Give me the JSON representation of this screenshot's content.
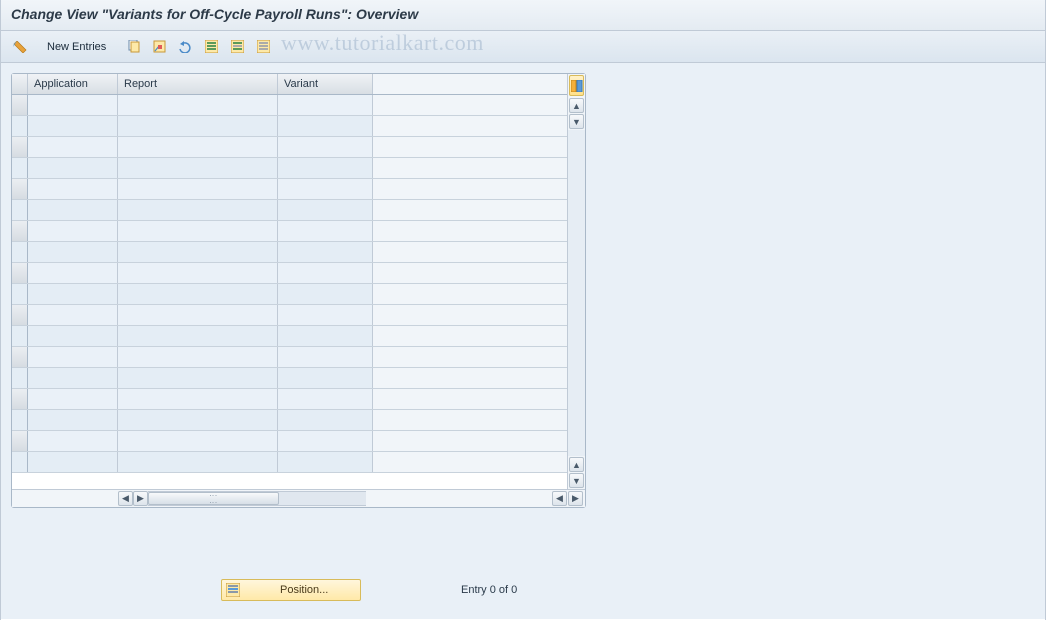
{
  "title": "Change View \"Variants for Off-Cycle Payroll Runs\": Overview",
  "toolbar": {
    "new_entries": "New Entries"
  },
  "watermark": "www.tutorialkart.com",
  "table": {
    "columns": [
      "Application",
      "Report",
      "Variant"
    ],
    "rows": [
      {
        "application": "",
        "report": "",
        "variant": ""
      },
      {
        "application": "",
        "report": "",
        "variant": ""
      },
      {
        "application": "",
        "report": "",
        "variant": ""
      },
      {
        "application": "",
        "report": "",
        "variant": ""
      },
      {
        "application": "",
        "report": "",
        "variant": ""
      },
      {
        "application": "",
        "report": "",
        "variant": ""
      },
      {
        "application": "",
        "report": "",
        "variant": ""
      },
      {
        "application": "",
        "report": "",
        "variant": ""
      },
      {
        "application": "",
        "report": "",
        "variant": ""
      },
      {
        "application": "",
        "report": "",
        "variant": ""
      },
      {
        "application": "",
        "report": "",
        "variant": ""
      },
      {
        "application": "",
        "report": "",
        "variant": ""
      },
      {
        "application": "",
        "report": "",
        "variant": ""
      },
      {
        "application": "",
        "report": "",
        "variant": ""
      },
      {
        "application": "",
        "report": "",
        "variant": ""
      },
      {
        "application": "",
        "report": "",
        "variant": ""
      },
      {
        "application": "",
        "report": "",
        "variant": ""
      },
      {
        "application": "",
        "report": "",
        "variant": ""
      }
    ]
  },
  "footer": {
    "position_label": "Position...",
    "entry_text": "Entry 0 of 0"
  },
  "icons": {
    "glasses": "glasses-icon",
    "copy": "copy-icon",
    "save_down": "save-down-icon",
    "undo": "undo-icon",
    "table1": "select-all-icon",
    "table2": "table-settings-icon",
    "table3": "print-icon"
  }
}
